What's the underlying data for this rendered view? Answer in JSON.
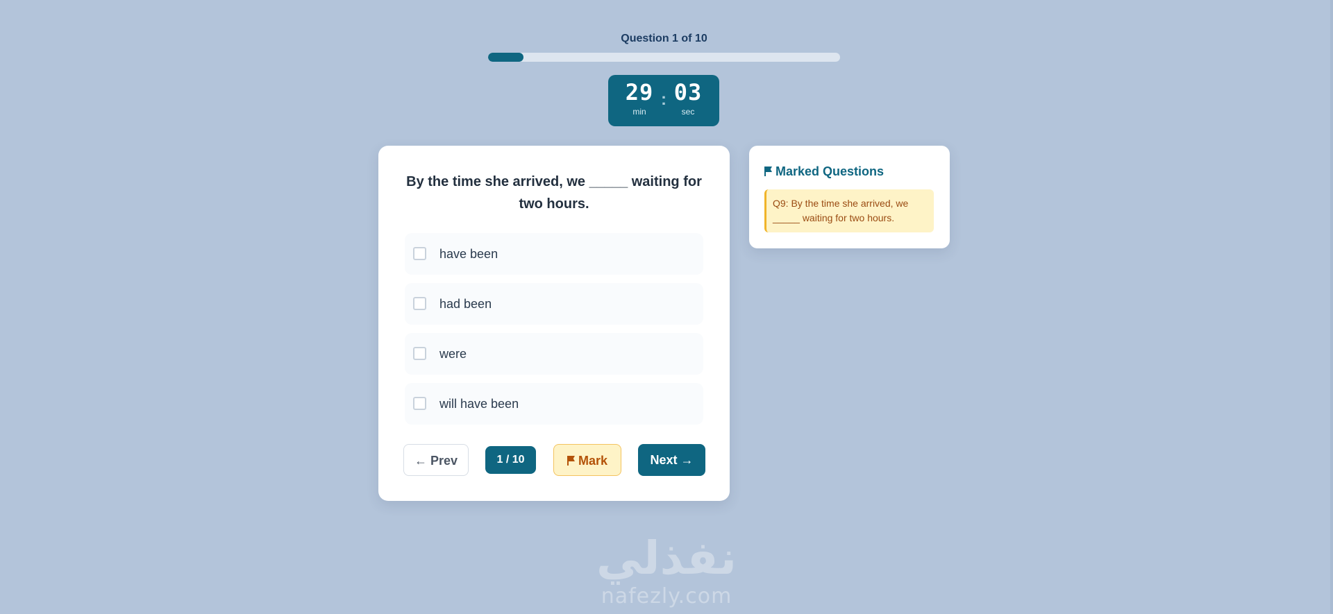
{
  "progress": {
    "label": "Question 1 of 10",
    "fraction": 0.1
  },
  "timer": {
    "minutes": "29",
    "minutes_label": "min",
    "separator": ":",
    "seconds": "03",
    "seconds_label": "sec"
  },
  "question": {
    "text": "By the time she arrived, we _____ waiting for two hours.",
    "options": [
      {
        "label": "have been"
      },
      {
        "label": "had been"
      },
      {
        "label": "were"
      },
      {
        "label": "will have been"
      }
    ]
  },
  "buttons": {
    "prev": "← Prev",
    "counter": "1 / 10",
    "mark": "Mark",
    "next": "Next →"
  },
  "marked_panel": {
    "title": "Marked Questions",
    "items": [
      {
        "text": "Q9: By the time she arrived, we _____ waiting for two hours."
      }
    ]
  },
  "logo": {
    "arabic": "نفذلي",
    "latin": "nafezly.com"
  },
  "colors": {
    "background": "#b3c4da",
    "primary": "#0f6681",
    "mark_bg": "#fef3c7",
    "mark_text": "#b45309"
  },
  "icons": {
    "mark": "flag-icon",
    "marked_title": "flag-icon"
  }
}
